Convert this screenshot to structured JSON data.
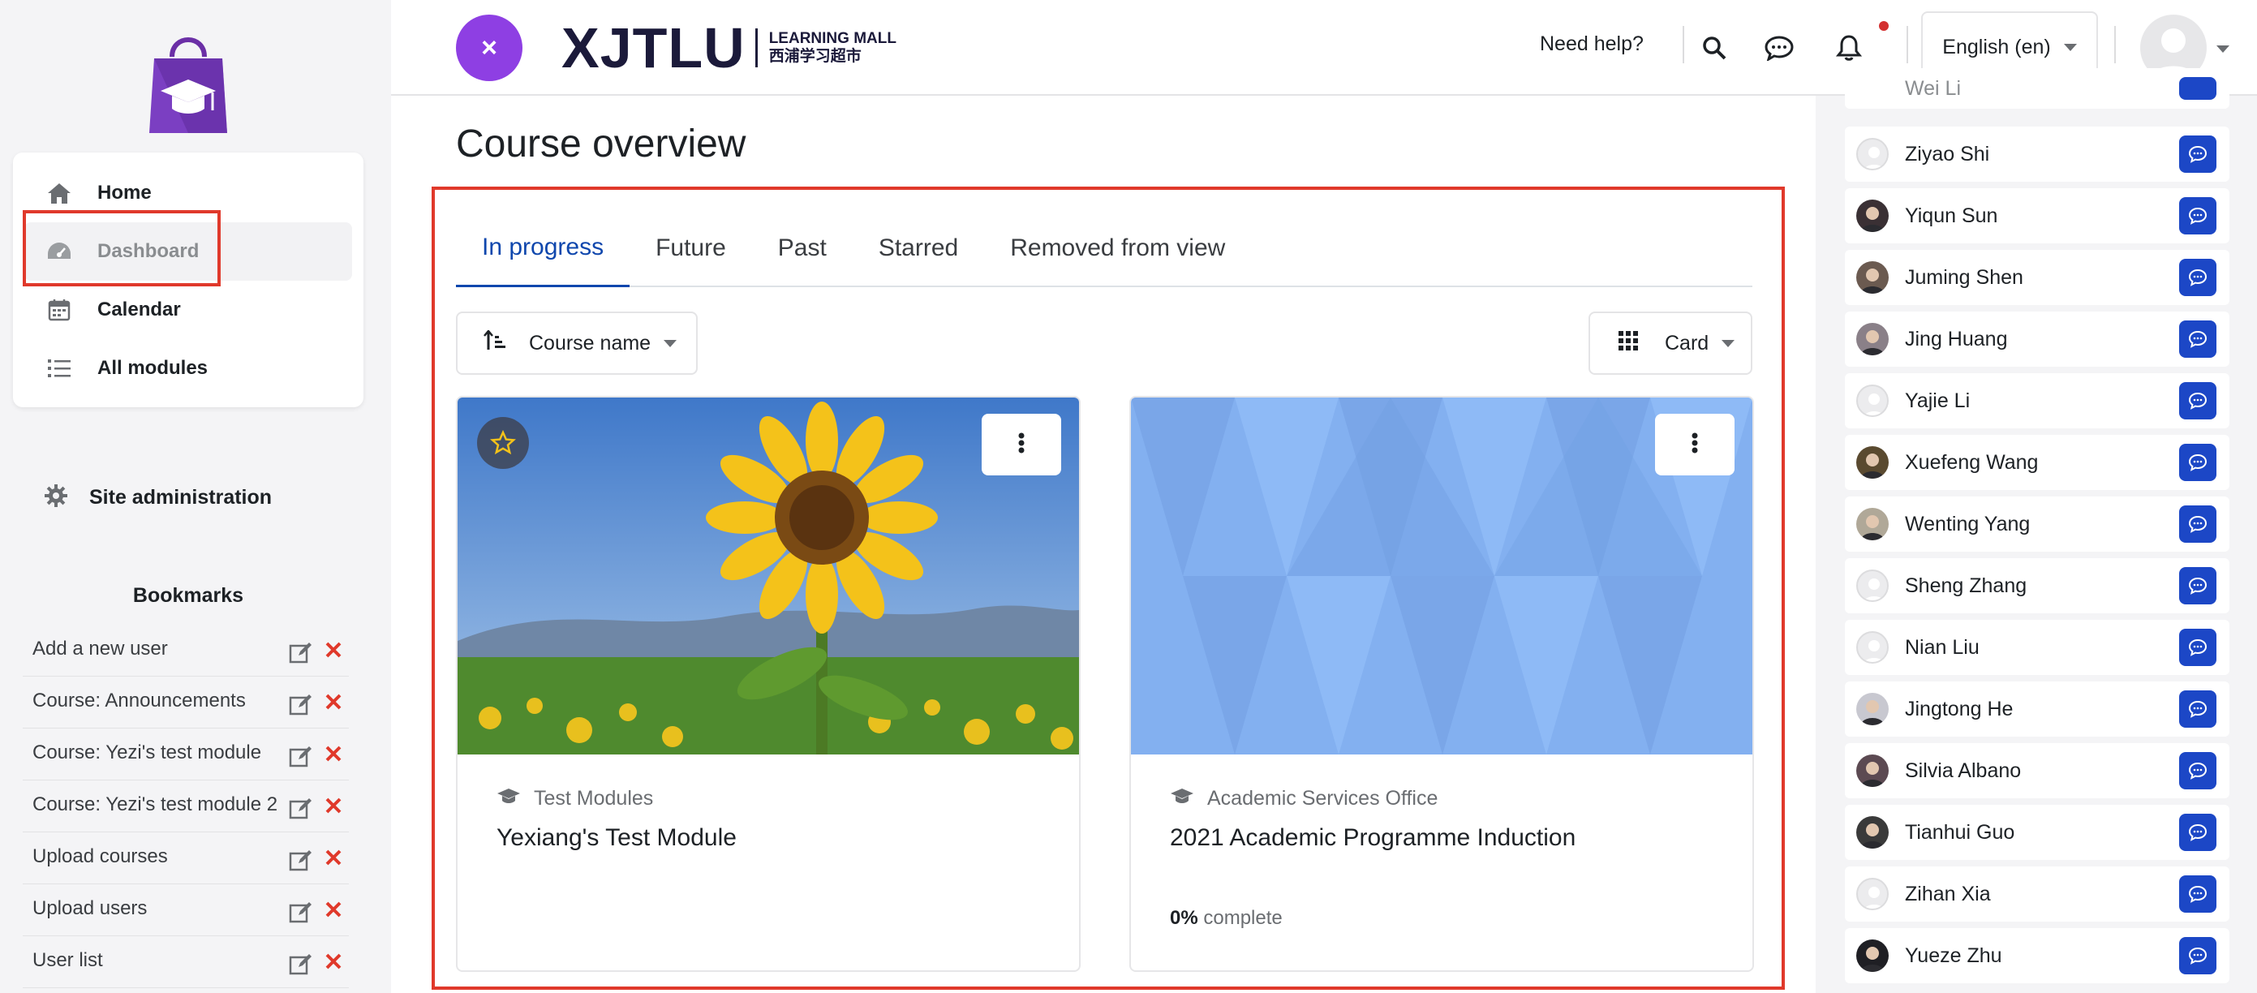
{
  "header": {
    "brand_main": "XJTLU",
    "brand_sub_en": "LEARNING MALL",
    "brand_sub_cn": "西浦学习超市",
    "close_glyph": "×",
    "help_label": "Need help?",
    "language": "English (en)",
    "icons": [
      "search-icon",
      "message-icon",
      "bell-icon"
    ]
  },
  "nav": {
    "items": [
      {
        "label": "Home",
        "icon": "home-icon"
      },
      {
        "label": "Dashboard",
        "icon": "dashboard-icon",
        "active": true
      },
      {
        "label": "Calendar",
        "icon": "calendar-icon"
      },
      {
        "label": "All modules",
        "icon": "list-icon"
      }
    ],
    "site_admin": "Site administration"
  },
  "bookmarks": {
    "title": "Bookmarks",
    "items": [
      {
        "label": "Add a new user"
      },
      {
        "label": "Course: Announcements"
      },
      {
        "label": "Course: Yezi's test module"
      },
      {
        "label": "Course: Yezi's test module 2"
      },
      {
        "label": "Upload courses"
      },
      {
        "label": "Upload users"
      },
      {
        "label": "User list"
      }
    ]
  },
  "main": {
    "title": "Course overview",
    "tabs": [
      "In progress",
      "Future",
      "Past",
      "Starred",
      "Removed from view"
    ],
    "sort_label": "Course name",
    "view_label": "Card",
    "courses": [
      {
        "category": "Test Modules",
        "name": "Yexiang's Test Module"
      },
      {
        "category": "Academic Services Office",
        "name": "2021 Academic Programme Induction",
        "progress_value": "0%",
        "progress_suffix": " complete"
      }
    ]
  },
  "contacts": {
    "partial_top": "Wei Li",
    "people": [
      "Ziyao Shi",
      "Yiqun Sun",
      "Juming Shen",
      "Jing Huang",
      "Yajie Li",
      "Xuefeng Wang",
      "Wenting Yang",
      "Sheng Zhang",
      "Nian Liu",
      "Jingtong He",
      "Silvia Albano",
      "Tianhui Guo",
      "Zihan Xia",
      "Yueze Zhu"
    ]
  },
  "colors": {
    "accent": "#0f47ad",
    "highlight": "#e0392b",
    "close_button": "#8e3fe3",
    "message_button": "#1c47c6"
  }
}
